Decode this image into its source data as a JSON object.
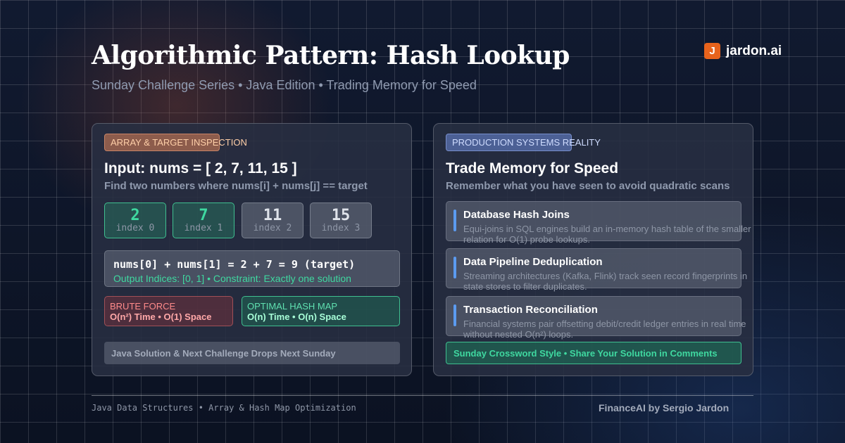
{
  "header": {
    "title": "Algorithmic Pattern: Hash Lookup",
    "subtitle": "Sunday Challenge Series • Java Edition • Trading Memory for Speed"
  },
  "brand": {
    "logo_letter": "J",
    "name": "jardon.ai",
    "logo_color": "#e8631c"
  },
  "left_card": {
    "badge": "ARRAY & TARGET INSPECTION",
    "heading": "Input: nums = [ 2, 7, 11, 15 ]",
    "subheading": "Find two numbers where nums[i] + nums[j] == target",
    "array": [
      {
        "value": "2",
        "index": "index 0",
        "highlight": true
      },
      {
        "value": "7",
        "index": "index 1",
        "highlight": true
      },
      {
        "value": "11",
        "index": "index 2",
        "highlight": false
      },
      {
        "value": "15",
        "index": "index 3",
        "highlight": false
      }
    ],
    "calc": {
      "expression": "nums[0] + nums[1] = 2 + 7 = 9 (target)",
      "output": "Output Indices: [0, 1]  •  Constraint: Exactly one solution"
    },
    "brute": {
      "label": "BRUTE FORCE",
      "value": "O(n²) Time • O(1) Space"
    },
    "optimal": {
      "label": "OPTIMAL HASH MAP",
      "value": "O(n) Time • O(n) Space"
    },
    "footer": "Java Solution & Next Challenge Drops Next Sunday"
  },
  "right_card": {
    "badge": "PRODUCTION SYSTEMS REALITY",
    "heading": "Trade Memory for Speed",
    "subheading": "Remember what you have seen to avoid quadratic scans",
    "systems": [
      {
        "title": "Database Hash Joins",
        "description": "Equi-joins in SQL engines build an in-memory hash table of the smaller relation for O(1) probe lookups."
      },
      {
        "title": "Data Pipeline Deduplication",
        "description": "Streaming architectures (Kafka, Flink) track seen record fingerprints in state stores to filter duplicates."
      },
      {
        "title": "Transaction Reconciliation",
        "description": "Financial systems pair offsetting debit/credit ledger entries in real time without nested O(n²) loops."
      }
    ],
    "footer": "Sunday Crossword Style • Share Your Solution in Comments"
  },
  "footer": {
    "left": "Java Data Structures • Array & Hash Map Optimization",
    "right": "FinanceAI by Sergio Jardon"
  },
  "colors": {
    "background": "#0d1526",
    "accent_green": "#3fd8a0",
    "accent_blue": "#5b9bf0",
    "accent_red": "#ff8a8a",
    "accent_orange": "#e8631c"
  }
}
